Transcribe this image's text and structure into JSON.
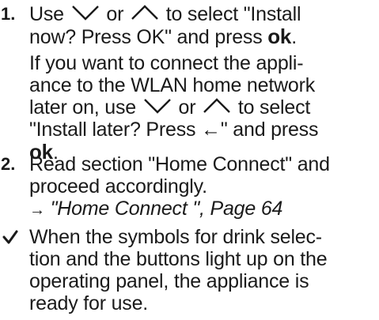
{
  "step1": {
    "number": "1.",
    "l1_pre": "Use",
    "l1_or": "or",
    "l1_post": "to select \"Install",
    "l2_pre": "now? Press OK\" and press",
    "ok": "ok",
    "l2_post": ".",
    "note_l1": "If you want to connect the appli-",
    "note_l2": "ance to the WLAN home network",
    "note_l3_pre": "later on, use",
    "note_l3_or": "or",
    "note_l3_post": "to select",
    "note_l4": "\"Install later? Press ←\" and press",
    "note_ok": "ok",
    "note_end": "."
  },
  "step2": {
    "number": "2.",
    "l1": "Read section \"Home Connect\" and",
    "l2": "proceed accordingly.",
    "ref_arrow": "→",
    "ref_text": "\"Home Connect \", Page 64"
  },
  "result": {
    "l1": "When the symbols for drink selec-",
    "l2": "tion and the buttons light up on the",
    "l3": "operating panel, the appliance is",
    "l4": "ready for use."
  },
  "icons": {
    "down": "chevron-down-icon",
    "up": "chevron-up-icon",
    "check": "check-icon"
  }
}
